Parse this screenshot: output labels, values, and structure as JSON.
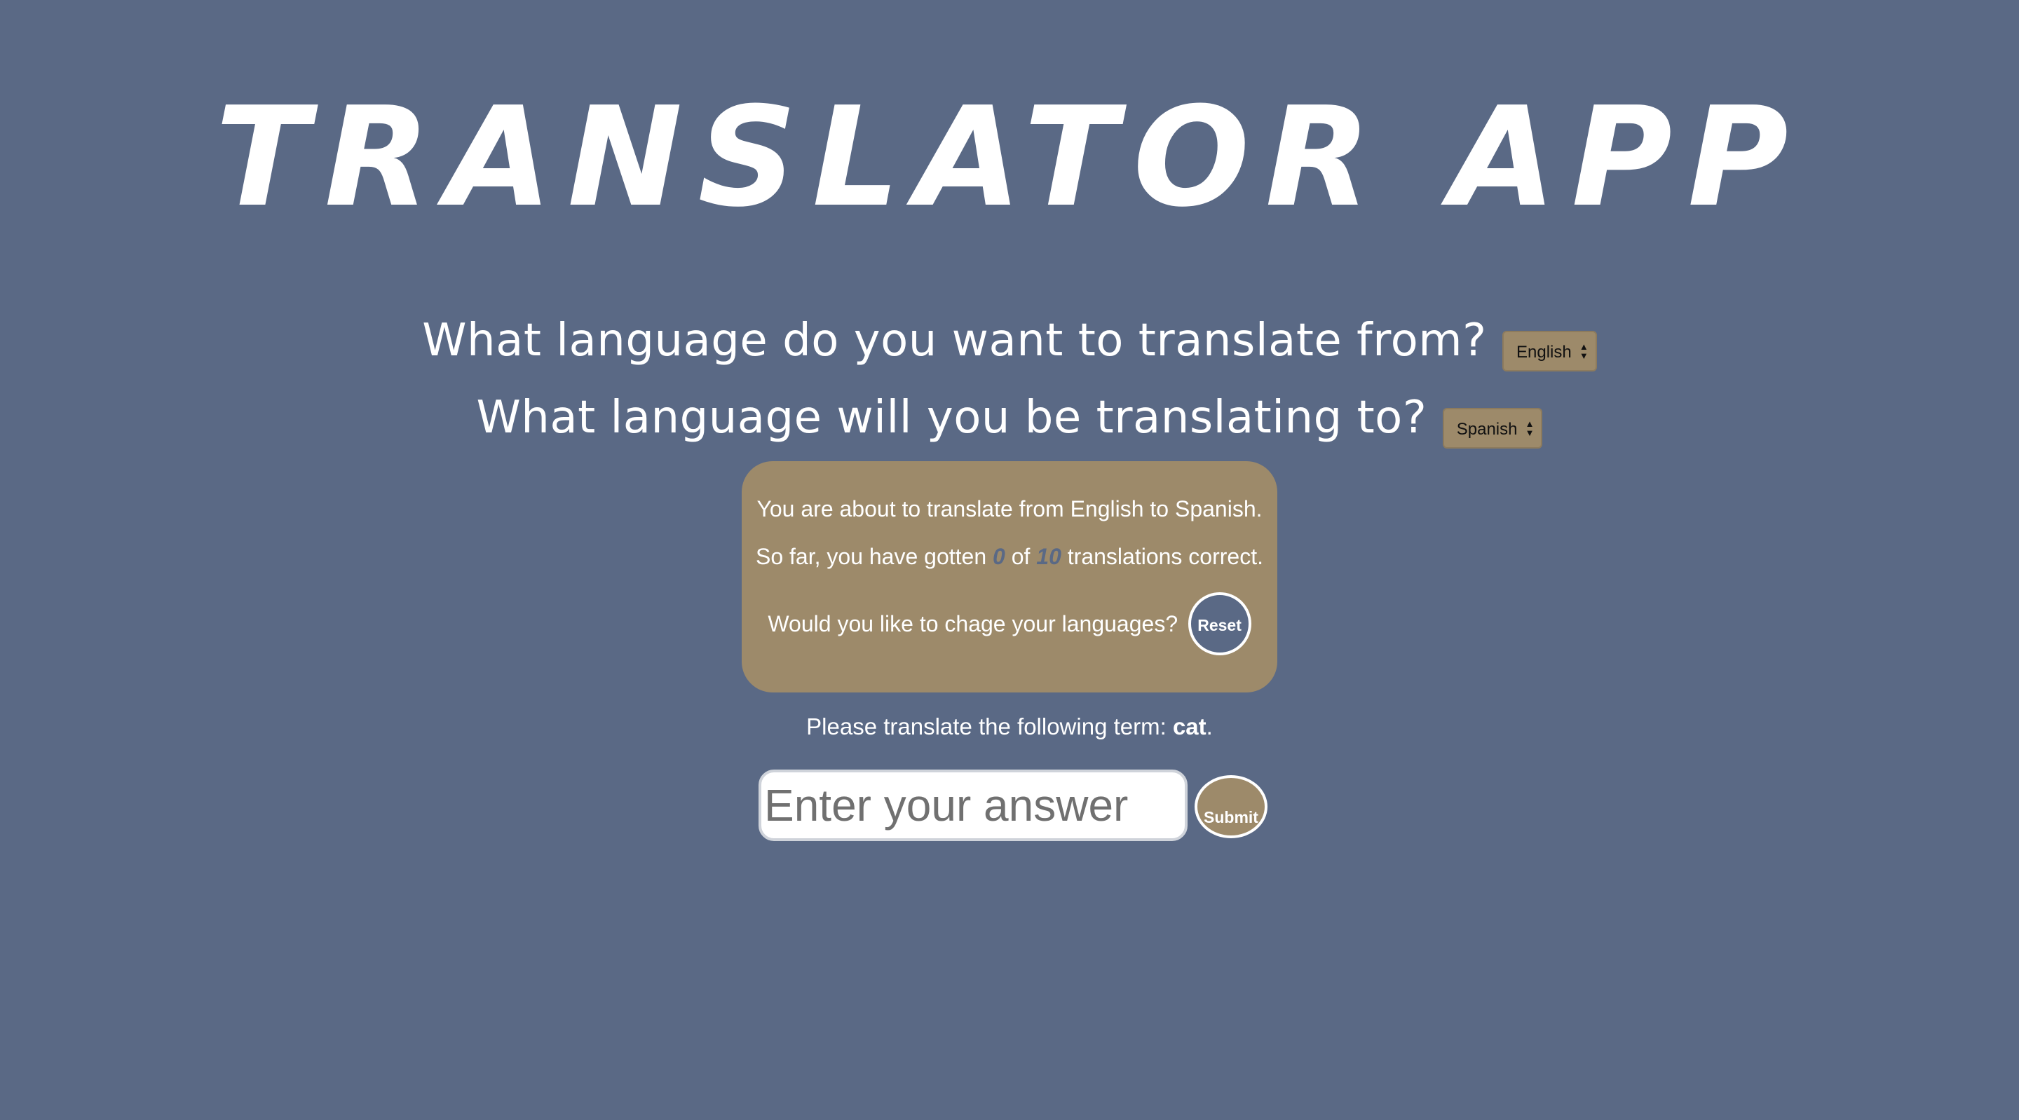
{
  "app": {
    "title": "TRANSLATOR APP"
  },
  "from_question": {
    "label": "What language do you want to translate from?",
    "selected": "English"
  },
  "to_question": {
    "label": "What language will you be translating to?",
    "selected": "Spanish"
  },
  "status": {
    "about_text": "You are about to translate from English to Spanish.",
    "progress_prefix": "So far, you have gotten",
    "correct_count": "0",
    "of_word": "of",
    "total_count": "10",
    "progress_suffix": "translations correct.",
    "change_prompt": "Would you like to chage your languages?",
    "reset_label": "Reset"
  },
  "quiz": {
    "prompt_prefix": "Please translate the following term:",
    "term": "cat",
    "prompt_suffix": ".",
    "answer_placeholder": "Enter your answer",
    "answer_value": "",
    "submit_label": "Submit"
  },
  "colors": {
    "background": "#5a6985",
    "accent": "#9d8a6a",
    "text": "#ffffff"
  },
  "icons": {
    "select_arrows": "select-arrows-icon"
  }
}
